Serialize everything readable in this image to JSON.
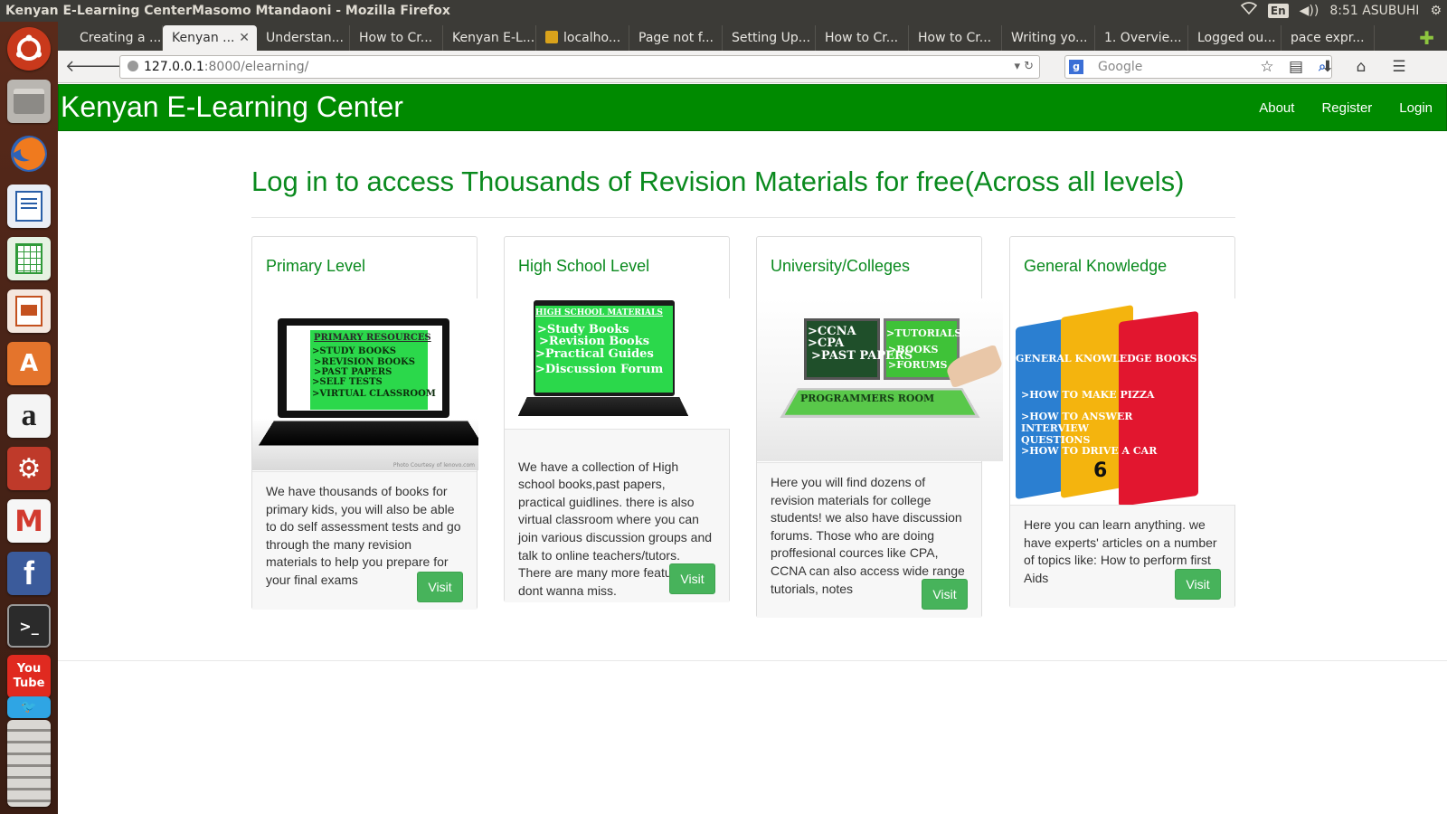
{
  "desktop": {
    "window_title": "Kenyan E-Learning CenterMasomo Mtandaoni - Mozilla Firefox",
    "keyboard_layout": "En",
    "clock": "8:51 ASUBUHI"
  },
  "launcher": {
    "items": [
      "ubuntu-dash",
      "files",
      "firefox",
      "writer",
      "calc",
      "impress",
      "software-center",
      "amazon",
      "system-settings",
      "gmail",
      "facebook",
      "terminal",
      "youtube",
      "twitter",
      "trash"
    ],
    "youtube_top": "You",
    "youtube_bottom": "Tube",
    "amazon_glyph": "a",
    "gmail_glyph": "M",
    "facebook_glyph": "f",
    "terminal_glyph": ">_"
  },
  "tabs": [
    {
      "label": "Creating a ..."
    },
    {
      "label": "Kenyan ...",
      "active": true
    },
    {
      "label": "Understan..."
    },
    {
      "label": "How to Cr..."
    },
    {
      "label": "Kenyan E-L..."
    },
    {
      "label": "localho..."
    },
    {
      "label": "Page not f..."
    },
    {
      "label": "Setting Up..."
    },
    {
      "label": "How to Cr..."
    },
    {
      "label": "How to Cr..."
    },
    {
      "label": "Writing yo..."
    },
    {
      "label": "1. Overvie..."
    },
    {
      "label": "Logged ou..."
    },
    {
      "label": "pace expr..."
    }
  ],
  "browser": {
    "url_host": "127.0.0.1",
    "url_path": ":8000/elearning/",
    "search_placeholder": "Google",
    "search_engine_glyph": "g"
  },
  "site": {
    "brand": "Kenyan E-Learning Center",
    "nav": {
      "about": "About",
      "register": "Register",
      "login": "Login"
    },
    "hero": "Log in to access Thousands of Revision Materials for free(Across all levels)",
    "brand_color": "#008a00",
    "button_color": "#47b35b"
  },
  "cards": [
    {
      "title": "Primary Level",
      "body": "We have thousands of books for primary kids, you will also be able to do self assessment tests and go through the many revision materials to help you prepare for your final exams",
      "button": "Visit",
      "image_lines": [
        "PRIMARY RESOURCES",
        ">STUDY BOOKS",
        ">REVISION BOOKS",
        ">PAST PAPERS",
        ">SELF TESTS",
        ">VIRTUAL CLASSROOM"
      ],
      "image_caption": "Photo Courtesy of lenovo.com"
    },
    {
      "title": "High School Level",
      "body": "We have a collection of High school books,past papers, practical guidlines. there is also virtual classroom where you can join various discussion groups and talk to online teachers/tutors.\nThere are many more features you dont wanna miss.",
      "button": "Visit",
      "image_lines": [
        "HIGH SCHOOL MATERIALS",
        ">Study Books",
        ">Revision Books",
        ">Practical Guides",
        ">Discussion Forum"
      ]
    },
    {
      "title": "University/Colleges",
      "body": "Here you will find dozens of revision materials for college students! we also have discussion forums. Those who are doing proffesional cources like CPA, CCNA can also access wide range tutorials, notes",
      "button": "Visit",
      "image_lines": [
        ">CCNA",
        ">CPA",
        ">PAST PAPERS",
        ">TUTORIALS",
        ">BOOKS",
        ">FORUMS",
        "PROGRAMMERS ROOM"
      ]
    },
    {
      "title": "General Knowledge",
      "body": "Here you can learn anything. we have experts' articles on a number of topics like: How to perform first Aids",
      "button": "Visit",
      "image_lines": [
        "GENERAL KNOWLEDGE BOOKS",
        ">HOW TO MAKE PIZZA",
        ">HOW TO ANSWER INTERVIEW QUESTIONS",
        ">HOW TO DRIVE A CAR",
        "6"
      ]
    }
  ]
}
